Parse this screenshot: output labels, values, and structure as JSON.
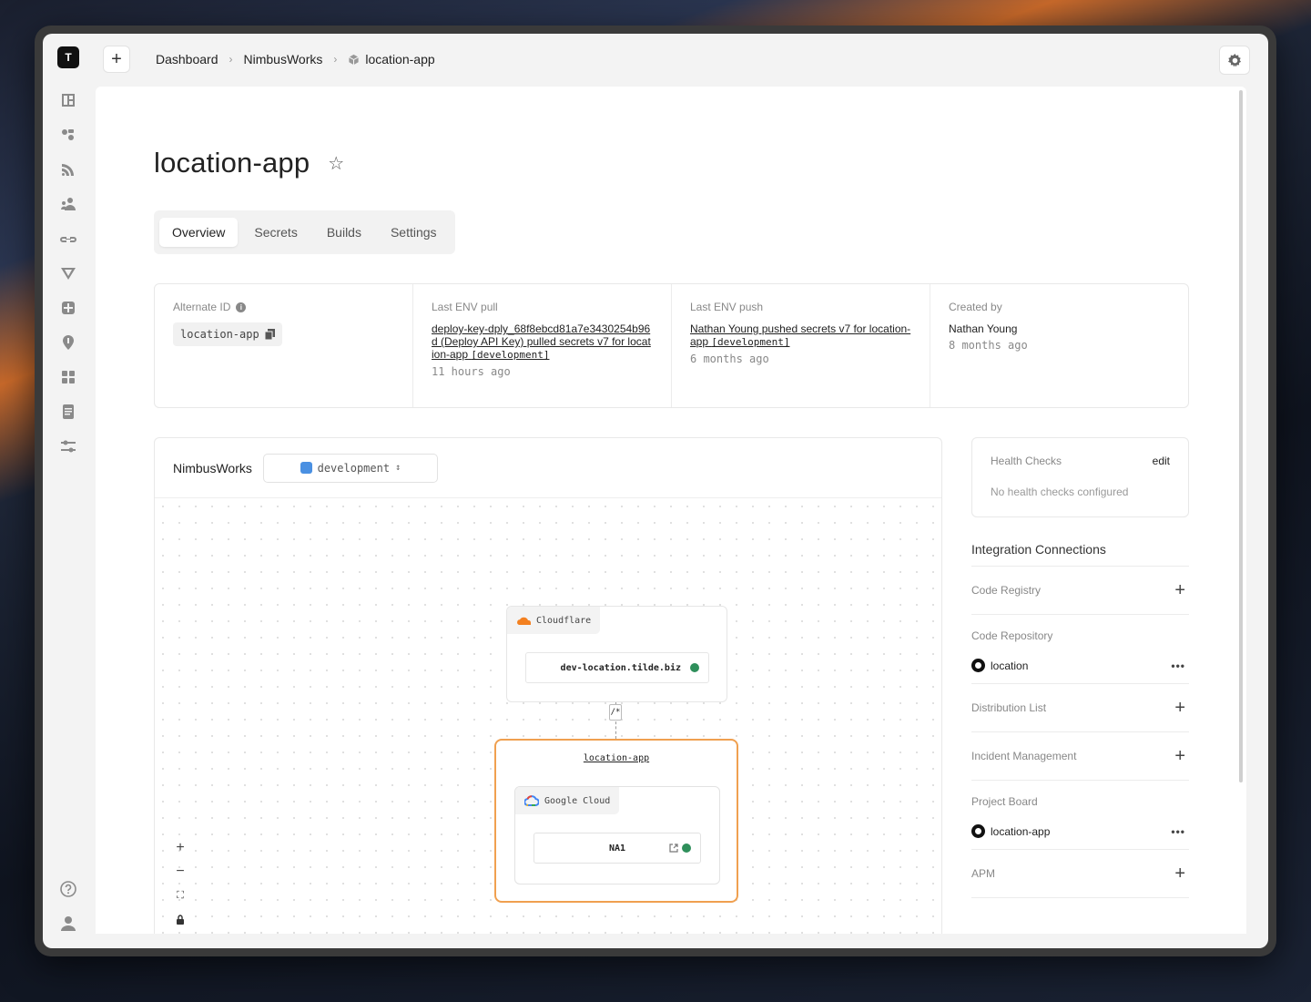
{
  "sidebar": {
    "logo": "T",
    "icons": [
      "dashboard-icon",
      "environments-icon",
      "feeds-icon",
      "team-icon",
      "link-icon",
      "vercel-icon",
      "extensions-icon",
      "location-pin-icon",
      "grid-icon",
      "document-icon",
      "sliders-icon"
    ],
    "bottom_icons": [
      "help-icon",
      "user-icon"
    ]
  },
  "topbar": {
    "breadcrumbs": [
      "Dashboard",
      "NimbusWorks",
      "location-app"
    ]
  },
  "page": {
    "title": "location-app",
    "tabs": [
      "Overview",
      "Secrets",
      "Builds",
      "Settings"
    ],
    "active_tab": "Overview"
  },
  "info": {
    "alternate_id_label": "Alternate ID",
    "alternate_id_value": "location-app",
    "last_pull_label": "Last ENV pull",
    "last_pull_text": "deploy-key-dply_68f8ebcd81a7e3430254b96d (Deploy API Key) pulled secrets v7 for location-app",
    "last_pull_env": "[development]",
    "last_pull_time": "11 hours ago",
    "last_push_label": "Last ENV push",
    "last_push_text": "Nathan Young pushed secrets v7 for location-app",
    "last_push_env": "[development]",
    "last_push_time": "6 months ago",
    "created_label": "Created by",
    "created_by": "Nathan Young",
    "created_time": "8 months ago"
  },
  "canvas": {
    "org": "NimbusWorks",
    "environment": "development",
    "env_color": "#4a90e2",
    "cloudflare_label": "Cloudflare",
    "domain": "dev-location.tilde.biz",
    "route": "/*",
    "app_link": "location-app",
    "gcloud_label": "Google Cloud",
    "region": "NA1",
    "accent_color": "#f0a050"
  },
  "health": {
    "title": "Health Checks",
    "edit": "edit",
    "empty": "No health checks configured"
  },
  "integrations": {
    "title": "Integration Connections",
    "code_registry": "Code Registry",
    "code_repository": "Code Repository",
    "code_repository_item": "location",
    "distribution_list": "Distribution List",
    "incident_management": "Incident Management",
    "project_board": "Project Board",
    "project_board_item": "location-app",
    "apm": "APM"
  }
}
